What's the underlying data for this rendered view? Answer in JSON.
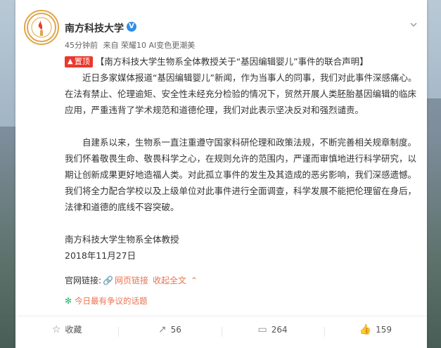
{
  "post": {
    "user_name": "南方科技大学",
    "time": "45分钟前",
    "source": "来自 荣耀10 AI变色更潮美",
    "pin_label": "置顶",
    "title": "【南方科技大学生物系全体教授关于“基因编辑婴儿”事件的联合声明】",
    "paragraphs": [
      "近日多家媒体报道“基因编辑婴儿”新闻，作为当事人的同事，我们对此事件深感痛心。在法有禁止、伦理逾矩、安全性未经充分检验的情况下，贸然开展人类胚胎基因编辑的临床应用，严重违背了学术规范和道德伦理，我们对此表示坚决反对和强烈谴责。",
      "自建系以来，生物系一直注重遵守国家科研伦理和政策法规，不断完善相关规章制度。我们怀着敬畏生命、敬畏科学之心，在规则允许的范围内，严谨而审慎地进行科学研究，以期让创新成果更好地造福人类。对此孤立事件的发生及其造成的恶劣影响，我们深感遗憾。我们将全力配合学校以及上级单位对此事件进行全面调查，科学发展不能把伦理留在身后，法律和道德的底线不容突破。"
    ],
    "signature": "南方科技大学生物系全体教授",
    "date": "2018年11月27日",
    "links_label": "官网链接:",
    "link_text": "网页链接",
    "collapse_text": "收起全文",
    "topic_text": "今日最有争议的话题"
  },
  "toolbar": {
    "favorite_label": "收藏",
    "share_count": "56",
    "comment_count": "264",
    "like_count": "159"
  },
  "icons": {
    "verified": "verified-icon",
    "chevron": "chevron-down-icon",
    "link": "link-icon",
    "topic": "topic-icon",
    "favorite": "star-icon",
    "share": "share-icon",
    "comment": "comment-icon",
    "like": "thumbs-up-icon"
  },
  "colors": {
    "accent": "#eb7350",
    "pin": "#e8392f",
    "verified": "#2f8ee8"
  }
}
